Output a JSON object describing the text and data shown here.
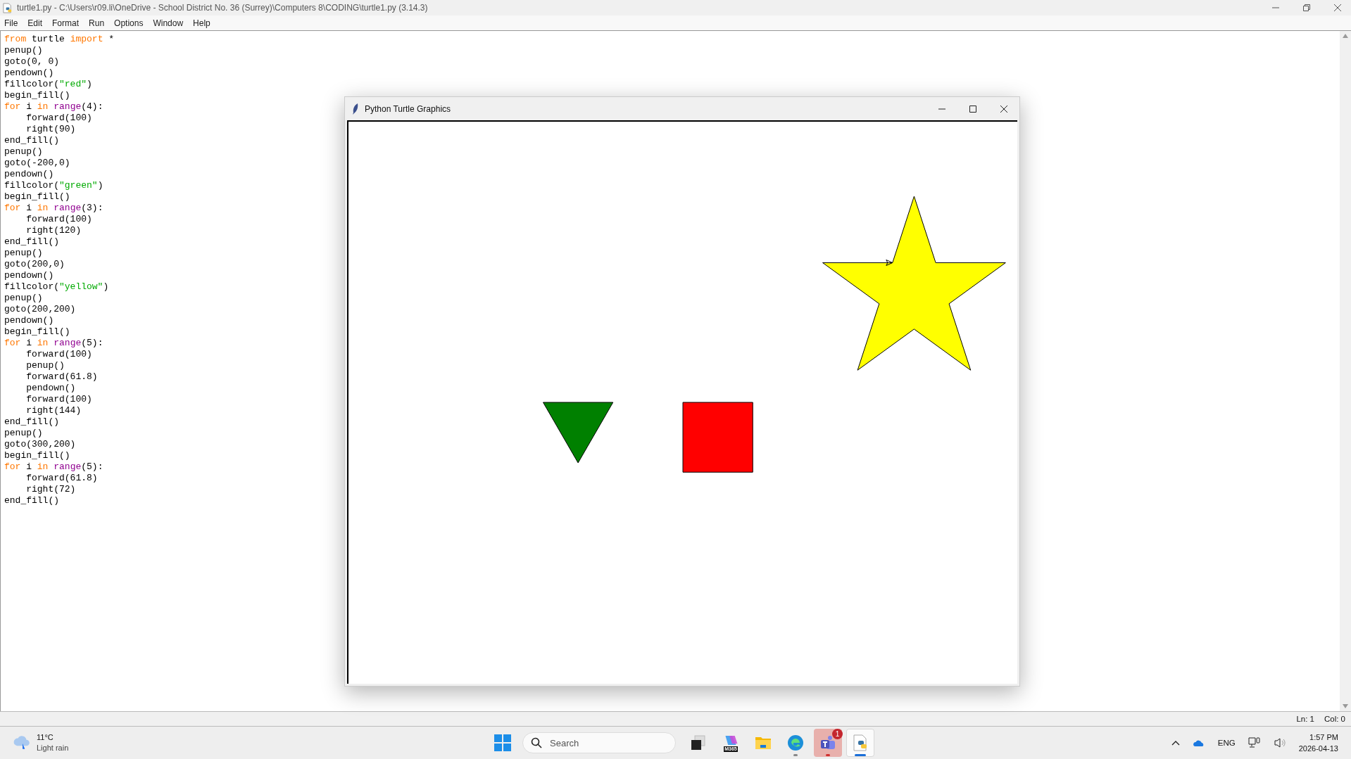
{
  "window": {
    "title": "turtle1.py - C:\\Users\\r09.li\\OneDrive - School District No. 36 (Surrey)\\Computers 8\\CODING\\turtle1.py (3.14.3)"
  },
  "menu": [
    "File",
    "Edit",
    "Format",
    "Run",
    "Options",
    "Window",
    "Help"
  ],
  "code": [
    {
      "tokens": [
        {
          "kind": "kw",
          "text": "from"
        },
        {
          "kind": "plain",
          "text": " turtle "
        },
        {
          "kind": "kw",
          "text": "import"
        },
        {
          "kind": "plain",
          "text": " *"
        }
      ]
    },
    {
      "tokens": [
        {
          "kind": "plain",
          "text": "penup()"
        }
      ]
    },
    {
      "tokens": [
        {
          "kind": "plain",
          "text": "goto(0, 0)"
        }
      ]
    },
    {
      "tokens": [
        {
          "kind": "plain",
          "text": "pendown()"
        }
      ]
    },
    {
      "tokens": [
        {
          "kind": "plain",
          "text": "fillcolor("
        },
        {
          "kind": "str",
          "text": "\"red\""
        },
        {
          "kind": "plain",
          "text": ")"
        }
      ]
    },
    {
      "tokens": [
        {
          "kind": "plain",
          "text": "begin_fill()"
        }
      ]
    },
    {
      "tokens": [
        {
          "kind": "kw",
          "text": "for"
        },
        {
          "kind": "plain",
          "text": " i "
        },
        {
          "kind": "kw",
          "text": "in"
        },
        {
          "kind": "builtin",
          "text": " range"
        },
        {
          "kind": "plain",
          "text": "(4):"
        }
      ],
      "children": [
        {
          "tokens": [
            {
              "kind": "plain",
              "text": "forward(100)"
            }
          ]
        },
        {
          "tokens": [
            {
              "kind": "plain",
              "text": "right(90)"
            }
          ]
        }
      ]
    },
    {
      "tokens": [
        {
          "kind": "plain",
          "text": "end_fill()"
        }
      ]
    },
    {
      "tokens": [
        {
          "kind": "plain",
          "text": "penup()"
        }
      ]
    },
    {
      "tokens": [
        {
          "kind": "plain",
          "text": "goto(-200,0)"
        }
      ]
    },
    {
      "tokens": [
        {
          "kind": "plain",
          "text": "pendown()"
        }
      ]
    },
    {
      "tokens": [
        {
          "kind": "plain",
          "text": "fillcolor("
        },
        {
          "kind": "str",
          "text": "\"green\""
        },
        {
          "kind": "plain",
          "text": ")"
        }
      ]
    },
    {
      "tokens": [
        {
          "kind": "plain",
          "text": "begin_fill()"
        }
      ]
    },
    {
      "tokens": [
        {
          "kind": "kw",
          "text": "for"
        },
        {
          "kind": "plain",
          "text": " i "
        },
        {
          "kind": "kw",
          "text": "in"
        },
        {
          "kind": "builtin",
          "text": " range"
        },
        {
          "kind": "plain",
          "text": "(3):"
        }
      ],
      "children": [
        {
          "tokens": [
            {
              "kind": "plain",
              "text": "forward(100)"
            }
          ]
        },
        {
          "tokens": [
            {
              "kind": "plain",
              "text": "right(120)"
            }
          ]
        }
      ]
    },
    {
      "tokens": [
        {
          "kind": "plain",
          "text": "end_fill()"
        }
      ]
    },
    {
      "tokens": [
        {
          "kind": "plain",
          "text": "penup()"
        }
      ]
    },
    {
      "tokens": [
        {
          "kind": "plain",
          "text": "goto(200,0)"
        }
      ]
    },
    {
      "tokens": [
        {
          "kind": "plain",
          "text": "pendown()"
        }
      ]
    },
    {
      "tokens": [
        {
          "kind": "plain",
          "text": "fillcolor("
        },
        {
          "kind": "str",
          "text": "\"yellow\""
        },
        {
          "kind": "plain",
          "text": ")"
        }
      ]
    },
    {
      "tokens": [
        {
          "kind": "plain",
          "text": "penup()"
        }
      ]
    },
    {
      "tokens": [
        {
          "kind": "plain",
          "text": "goto(200,200)"
        }
      ]
    },
    {
      "tokens": [
        {
          "kind": "plain",
          "text": "pendown()"
        }
      ]
    },
    {
      "tokens": [
        {
          "kind": "plain",
          "text": "begin_fill()"
        }
      ]
    },
    {
      "tokens": [
        {
          "kind": "kw",
          "text": "for"
        },
        {
          "kind": "plain",
          "text": " i "
        },
        {
          "kind": "kw",
          "text": "in"
        },
        {
          "kind": "builtin",
          "text": " range"
        },
        {
          "kind": "plain",
          "text": "(5):"
        }
      ],
      "children": [
        {
          "tokens": [
            {
              "kind": "plain",
              "text": "forward(100)"
            }
          ]
        },
        {
          "tokens": [
            {
              "kind": "plain",
              "text": "penup()"
            }
          ]
        },
        {
          "tokens": [
            {
              "kind": "plain",
              "text": "forward(61.8)"
            }
          ]
        },
        {
          "tokens": [
            {
              "kind": "plain",
              "text": "pendown()"
            }
          ]
        },
        {
          "tokens": [
            {
              "kind": "plain",
              "text": "forward(100)"
            }
          ]
        },
        {
          "tokens": [
            {
              "kind": "plain",
              "text": "right(144)"
            }
          ]
        }
      ]
    },
    {
      "tokens": [
        {
          "kind": "plain",
          "text": "end_fill()"
        }
      ]
    },
    {
      "tokens": [
        {
          "kind": "plain",
          "text": "penup()"
        }
      ]
    },
    {
      "tokens": [
        {
          "kind": "plain",
          "text": "goto(300,200)"
        }
      ]
    },
    {
      "tokens": [
        {
          "kind": "plain",
          "text": "begin_fill()"
        }
      ]
    },
    {
      "tokens": [
        {
          "kind": "kw",
          "text": "for"
        },
        {
          "kind": "plain",
          "text": " i "
        },
        {
          "kind": "kw",
          "text": "in"
        },
        {
          "kind": "builtin",
          "text": " range"
        },
        {
          "kind": "plain",
          "text": "(5):"
        }
      ],
      "children": [
        {
          "tokens": [
            {
              "kind": "plain",
              "text": "forward(61.8)"
            }
          ]
        },
        {
          "tokens": [
            {
              "kind": "plain",
              "text": "right(72)"
            }
          ]
        }
      ]
    },
    {
      "tokens": [
        {
          "kind": "plain",
          "text": "end_fill()"
        }
      ]
    }
  ],
  "status_bar": {
    "line": "Ln: 1",
    "column": "Col: 0"
  },
  "turtle_window": {
    "title": "Python Turtle Graphics",
    "shapes": [
      {
        "kind": "square",
        "color": "#ff0000"
      },
      {
        "kind": "triangle",
        "color": "#008000"
      },
      {
        "kind": "star",
        "color": "#ffff00"
      }
    ]
  },
  "taskbar": {
    "weather": {
      "temperature": "11°C",
      "condition": "Light rain"
    },
    "search": {
      "placeholder": "Search"
    },
    "apps": [
      {
        "kind": "taskview",
        "running": false,
        "selected": false,
        "attention": false
      },
      {
        "kind": "m365",
        "label": "M365",
        "running": false,
        "selected": false,
        "attention": false
      },
      {
        "kind": "explorer",
        "running": false,
        "selected": false,
        "attention": false
      },
      {
        "kind": "edge",
        "running": true,
        "selected": false,
        "attention": false
      },
      {
        "kind": "teams",
        "badge": "1",
        "running": true,
        "selected": false,
        "attention": true
      },
      {
        "kind": "python",
        "running": true,
        "selected": true,
        "attention": false
      }
    ],
    "language": "ENG",
    "time": "1:57 PM",
    "date": "2026-04-13"
  }
}
